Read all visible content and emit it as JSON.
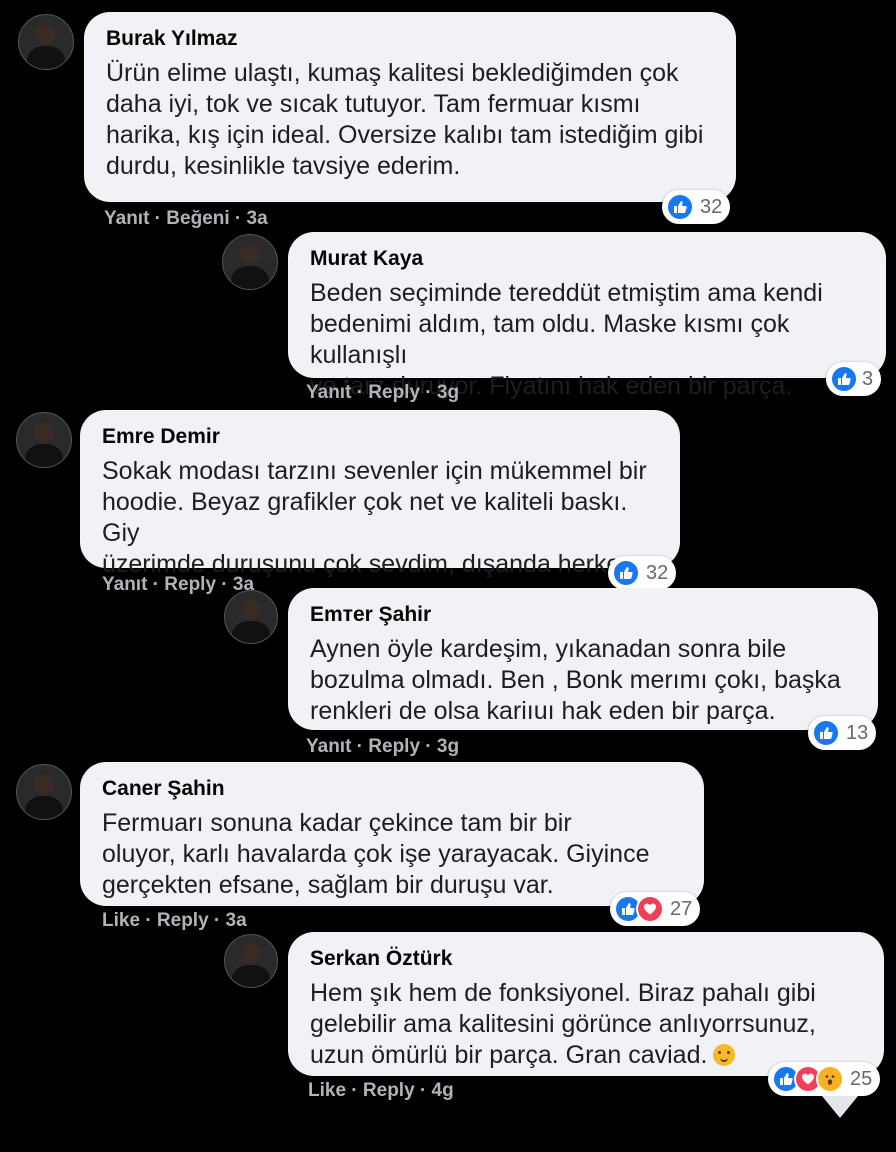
{
  "comments": [
    {
      "name": "Burak Yılmaz",
      "lines": [
        "Ürün elime ulaştı, kumaş kalitesi beklediğimden çok",
        "daha iyi, tok ve sıcak tutuyor. Tam fermuar kısmı",
        "harika, kış için ideal. Oversize kalıbı tam istediğim gibi",
        "durdu, kesinlikle tavsiye ederim."
      ],
      "meta": "Yanıt · Beğeni · 3a",
      "reaction_count": "32",
      "reaction_icons": [
        "like-icon"
      ]
    },
    {
      "name": "Murat Kaya",
      "lines": [
        "Beden seçiminde tereddüt etmiştim ama kendi",
        "bedenimi aldım, tam oldu. Maske kısmı çok kullanışlı",
        "ve tarz duruyor. Fiyatını hak eden bir parça."
      ],
      "meta": "Yanıt · Reply · 3g",
      "reaction_count": "3",
      "reaction_icons": [
        "like-icon"
      ]
    },
    {
      "name": "Emre Demir",
      "lines": [
        "Sokak modası tarzını sevenler için mükemmel bir",
        "hoodie. Beyaz grafikler çok net ve kaliteli baskı. Giy",
        "üzerimde duruşunu çok sevdim, dışanda herkes"
      ],
      "meta": "Yanıt · Reply · 3a",
      "reaction_count": "32",
      "reaction_icons": [
        "like-icon"
      ]
    },
    {
      "name": "Emтer Şahir",
      "lines": [
        "Aynen öyle kardeşim, yıkanadan sonra bile",
        "bozulma olmadı. Ben , Bonk merımı çokı, başka",
        "renkleri de olsa kariıuı hak eden bir parça."
      ],
      "meta": "Yanıt · Reply · 3g",
      "reaction_count": "13",
      "reaction_icons": [
        "like-icon"
      ]
    },
    {
      "name": "Caner Şahin",
      "lines": [
        "Fermuarı sonuna kadar çekince tam bir bir",
        "oluyor, karlı havalarda çok işe yarayacak. Giyince",
        "gerçekten efsane, sağlam bir duruşu var."
      ],
      "meta": "Like · Reply · 3a",
      "reaction_count": "27",
      "reaction_icons": [
        "like-icon",
        "love-icon"
      ]
    },
    {
      "name": "Serkan Öztürk",
      "lines": [
        "Hem şık hem de fonksiyonel. Biraz pahalı gibi",
        "gelebilir ama kalitesini görünce anlıyorrsunuz,",
        "uzun ömürlü bir parça. Gran caviad."
      ],
      "meta": "Like · Reply · 4g",
      "reaction_count": "25",
      "reaction_icons": [
        "like-icon",
        "love-icon",
        "wow-icon"
      ]
    }
  ]
}
